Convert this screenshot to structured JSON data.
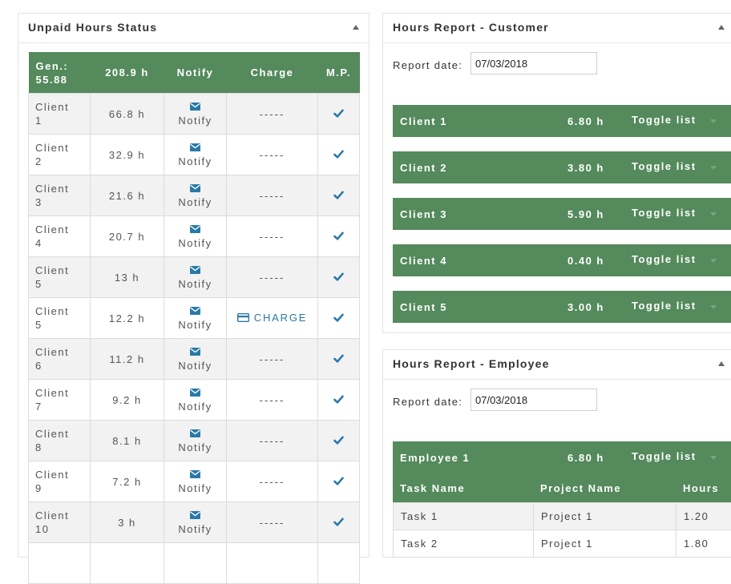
{
  "unpaid": {
    "title": "Unpaid Hours Status",
    "headers": {
      "gen_label": "Gen.:",
      "gen_value": "55.88",
      "total": "208.9 h",
      "notify": "Notify",
      "charge": "Charge",
      "mp": "M.P."
    },
    "rows": [
      {
        "client_a": "Client",
        "client_b": "1",
        "hours": "66.8 h",
        "notify": "Notify",
        "charge": "-----"
      },
      {
        "client_a": "Client",
        "client_b": "2",
        "hours": "32.9 h",
        "notify": "Notify",
        "charge": "-----"
      },
      {
        "client_a": "Client",
        "client_b": "3",
        "hours": "21.6 h",
        "notify": "Notify",
        "charge": "-----"
      },
      {
        "client_a": "Client",
        "client_b": "4",
        "hours": "20.7 h",
        "notify": "Notify",
        "charge": "-----"
      },
      {
        "client_a": "Client",
        "client_b": "5",
        "hours": "13 h",
        "notify": "Notify",
        "charge": "-----"
      },
      {
        "client_a": "Client",
        "client_b": "5",
        "hours": "12.2 h",
        "notify": "Notify",
        "charge": "CHARGE"
      },
      {
        "client_a": "Client",
        "client_b": "6",
        "hours": "11.2 h",
        "notify": "Notify",
        "charge": "-----"
      },
      {
        "client_a": "Client",
        "client_b": "7",
        "hours": "9.2 h",
        "notify": "Notify",
        "charge": "-----"
      },
      {
        "client_a": "Client",
        "client_b": "8",
        "hours": "8.1 h",
        "notify": "Notify",
        "charge": "-----"
      },
      {
        "client_a": "Client",
        "client_b": "9",
        "hours": "7.2 h",
        "notify": "Notify",
        "charge": "-----"
      },
      {
        "client_a": "Client",
        "client_b": "10",
        "hours": "3 h",
        "notify": "Notify",
        "charge": "-----"
      },
      {
        "client_a": "",
        "client_b": "",
        "hours": "",
        "notify": "",
        "charge": ""
      }
    ]
  },
  "customer": {
    "title": "Hours Report - Customer",
    "report_label": "Report date:",
    "report_date": "07/03/2018",
    "clients": [
      {
        "name": "Client 1",
        "hours": "6.80 h",
        "toggle": "Toggle list"
      },
      {
        "name": "Client 2",
        "hours": "3.80 h",
        "toggle": "Toggle list"
      },
      {
        "name": "Client 3",
        "hours": "5.90 h",
        "toggle": "Toggle list"
      },
      {
        "name": "Client 4",
        "hours": "0.40 h",
        "toggle": "Toggle list"
      },
      {
        "name": "Client 5",
        "hours": "3.00 h",
        "toggle": "Toggle list"
      }
    ]
  },
  "employee": {
    "title": "Hours Report - Employee",
    "report_label": "Report date:",
    "report_date": "07/03/2018",
    "employee": {
      "name": "Employee 1",
      "hours": "6.80 h",
      "toggle": "Toggle list"
    },
    "columns": {
      "task": "Task Name",
      "project": "Project Name",
      "hours": "Hours"
    },
    "tasks": [
      {
        "task": "Task 1",
        "project": "Project 1",
        "hours": "1.20"
      },
      {
        "task": "Task 2",
        "project": "Project 1",
        "hours": "1.80"
      }
    ]
  },
  "colors": {
    "accent_green": "#548a5c",
    "link_blue": "#2a79a6"
  }
}
